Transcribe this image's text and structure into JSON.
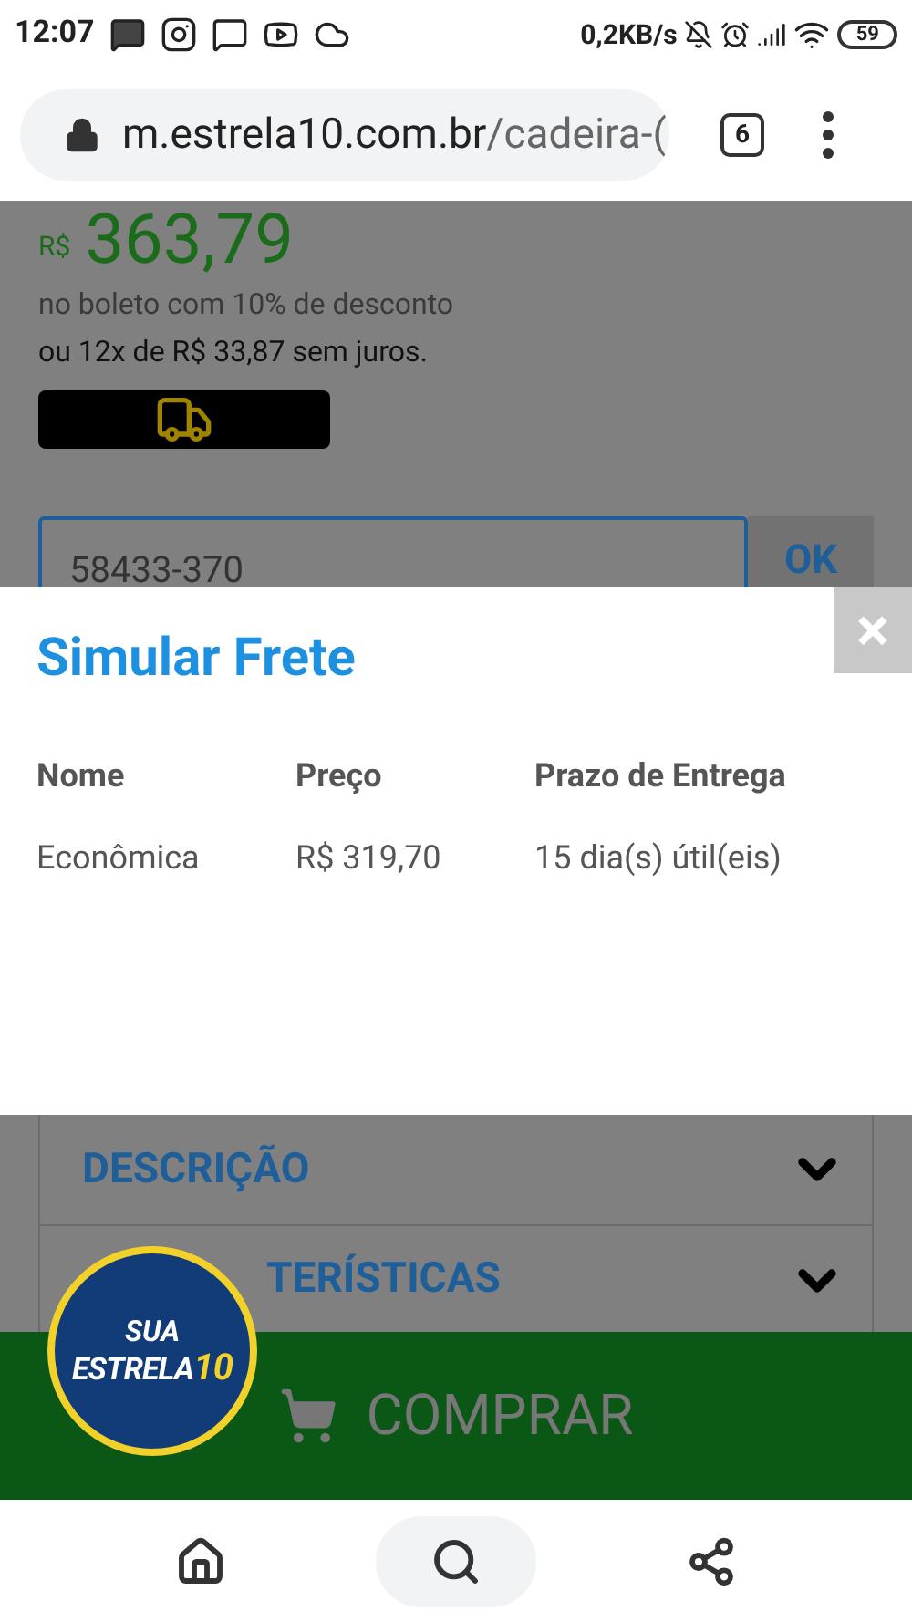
{
  "status_bar": {
    "time": "12:07",
    "speed": "0,2KB/s",
    "battery": "59"
  },
  "browser": {
    "url_host": "m.estrela10.com.br",
    "url_path": "/cadeira-(",
    "tab_count": "6"
  },
  "product": {
    "currency": "R$",
    "price": "363,79",
    "boleto_note": "no boleto com 10% de desconto",
    "installments": "ou 12x de R$ 33,87 sem juros.",
    "cep_value": "58433-370",
    "ok_label": "OK"
  },
  "modal": {
    "title": "Simular Frete",
    "close": "×",
    "columns": [
      "Nome",
      "Preço",
      "Prazo de Entrega"
    ],
    "rows": [
      [
        "Econômica",
        "R$ 319,70",
        "15 dia(s) útil(eis)"
      ]
    ]
  },
  "sections": [
    {
      "label": "DESCRIÇÃO",
      "expanded": false
    },
    {
      "label": "TERÍSTICAS",
      "expanded": false
    }
  ],
  "logo": {
    "top": "SUA",
    "brand": "ESTRELA",
    "number": "10"
  },
  "buy_button": {
    "label": "COMPRAR"
  },
  "bottom_nav": [
    {
      "kind": "home",
      "selected": false
    },
    {
      "kind": "search",
      "selected": true
    },
    {
      "kind": "share",
      "selected": false
    }
  ]
}
